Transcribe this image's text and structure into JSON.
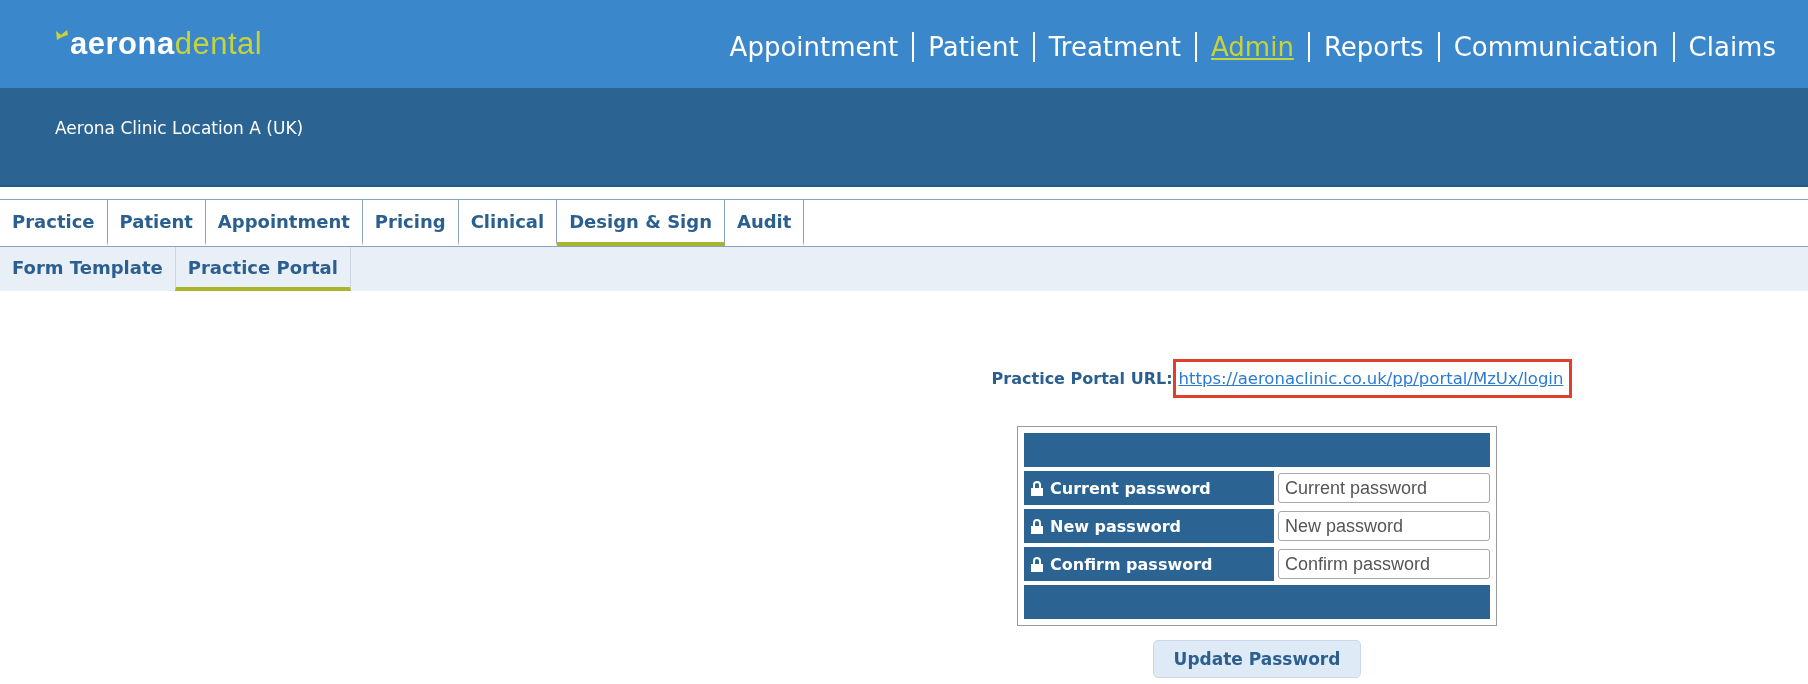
{
  "logo": {
    "first": "aerona",
    "second": "dental"
  },
  "nav": [
    {
      "label": "Appointment",
      "selected": false
    },
    {
      "label": "Patient",
      "selected": false
    },
    {
      "label": "Treatment",
      "selected": false
    },
    {
      "label": "Admin",
      "selected": true
    },
    {
      "label": "Reports",
      "selected": false
    },
    {
      "label": "Communication",
      "selected": false
    },
    {
      "label": "Claims",
      "selected": false
    }
  ],
  "location": "Aerona Clinic Location A (UK)",
  "tabs": [
    {
      "label": "Practice",
      "selected": false
    },
    {
      "label": "Patient",
      "selected": false
    },
    {
      "label": "Appointment",
      "selected": false
    },
    {
      "label": "Pricing",
      "selected": false
    },
    {
      "label": "Clinical",
      "selected": false
    },
    {
      "label": "Design & Sign",
      "selected": true
    },
    {
      "label": "Audit",
      "selected": false
    }
  ],
  "subtabs": [
    {
      "label": "Form Template",
      "selected": false
    },
    {
      "label": "Practice Portal",
      "selected": true
    }
  ],
  "portal_url": {
    "label": "Practice Portal URL:",
    "link": "https://aeronaclinic.co.uk/pp/portal/MzUx/login",
    "highlighted": true
  },
  "password_form": {
    "fields": [
      {
        "label": "Current password",
        "placeholder": "Current password"
      },
      {
        "label": "New password",
        "placeholder": "New password"
      },
      {
        "label": "Confirm password",
        "placeholder": "Confirm password"
      }
    ],
    "button": "Update Password"
  }
}
